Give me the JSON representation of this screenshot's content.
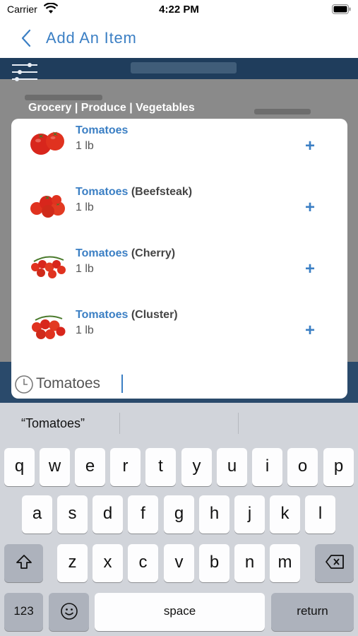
{
  "status_bar": {
    "carrier": "Carrier",
    "time": "4:22 PM"
  },
  "nav": {
    "title": "Add An Item",
    "back_icon": "chevron-left-icon"
  },
  "filter": {
    "icon": "sliders-icon"
  },
  "category": {
    "path": "Grocery | Produce | Vegetables"
  },
  "results": [
    {
      "highlight": "Tomatoes",
      "suffix": "",
      "quantity": "1 lb",
      "add_label": "+"
    },
    {
      "highlight": "Tomatoes",
      "suffix": " (Beefsteak)",
      "quantity": "1 lb",
      "add_label": "+"
    },
    {
      "highlight": "Tomatoes",
      "suffix": " (Cherry)",
      "quantity": "1 lb",
      "add_label": "+"
    },
    {
      "highlight": "Tomatoes",
      "suffix": " (Cluster)",
      "quantity": "1 lb",
      "add_label": "+"
    }
  ],
  "search": {
    "value": "Tomatoes",
    "icon": "clock-icon"
  },
  "keyboard": {
    "suggestion": "“Tomatoes”",
    "row1": [
      "q",
      "w",
      "e",
      "r",
      "t",
      "y",
      "u",
      "i",
      "o",
      "p"
    ],
    "row2": [
      "a",
      "s",
      "d",
      "f",
      "g",
      "h",
      "j",
      "k",
      "l"
    ],
    "row3": [
      "z",
      "x",
      "c",
      "v",
      "b",
      "n",
      "m"
    ],
    "numbers_label": "123",
    "space_label": "space",
    "return_label": "return"
  },
  "colors": {
    "accent": "#3b7fc4",
    "keyboard_bg": "#d1d4da",
    "dim_bg": "#8a8a8a",
    "header_dark": "#1f3d5c"
  }
}
